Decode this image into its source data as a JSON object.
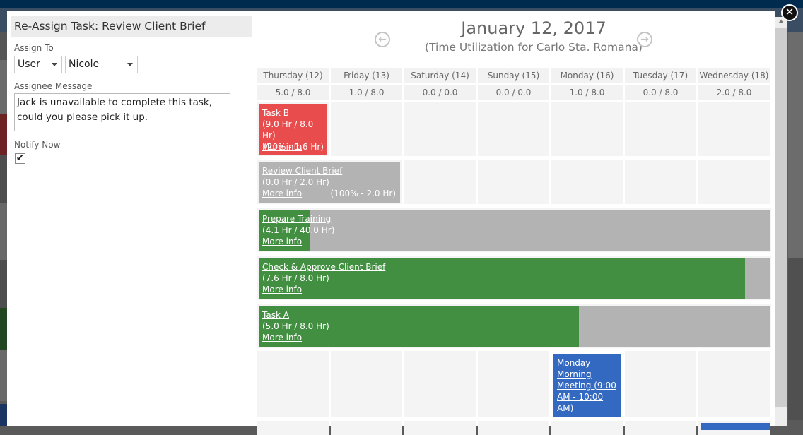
{
  "dialog": {
    "title": "Re-Assign Task: Review Client Brief",
    "assign_to_label": "Assign To",
    "assign_type": "User",
    "assignee": "Nicole",
    "message_label": "Assignee Message",
    "message": "Jack is unavailable to complete this task, could you please pick it up.",
    "notify_label": "Notify Now",
    "notify_checked": true,
    "checkmark": "✔"
  },
  "calendar": {
    "date_title": "January 12, 2017",
    "subtitle": "(Time Utilization for Carlo Sta. Romana)",
    "prev_icon": "←",
    "next_icon": "→",
    "days": [
      {
        "label": "Thursday (12)",
        "usage": "5.0 / 8.0"
      },
      {
        "label": "Friday (13)",
        "usage": "1.0 / 8.0"
      },
      {
        "label": "Saturday (14)",
        "usage": "0.0 / 0.0"
      },
      {
        "label": "Sunday (15)",
        "usage": "0.0 / 0.0"
      },
      {
        "label": "Monday (16)",
        "usage": "1.0 / 8.0"
      },
      {
        "label": "Tuesday (17)",
        "usage": "0.0 / 8.0"
      },
      {
        "label": "Wednesday (18)",
        "usage": "2.0 / 8.0"
      }
    ],
    "tasks": [
      {
        "name": "Task B",
        "hours": "(9.0 Hr / 8.0 Hr)",
        "more": "More info",
        "pct": "(20% - 1.6 Hr)",
        "color": "#e84c4c",
        "progress": 1.0
      },
      {
        "name": "Review Client Brief",
        "hours": "(0.0 Hr / 2.0 Hr)",
        "more": "More info",
        "pct": "(100% - 2.0 Hr)",
        "color": "#b3b3b3",
        "progress": 0.0
      },
      {
        "name": "Prepare Training",
        "hours": "(4.1 Hr / 40.0 Hr)",
        "more": "More info",
        "color": "#438f42",
        "progress": 0.1
      },
      {
        "name": "Check & Approve Client Brief",
        "hours": "(7.6 Hr / 8.0 Hr)",
        "more": "More info",
        "color": "#438f42",
        "progress": 0.95
      },
      {
        "name": "Task A",
        "hours": "(5.0 Hr / 8.0 Hr)",
        "more": "More info",
        "color": "#438f42",
        "progress": 0.625
      }
    ],
    "meeting": {
      "label": "Monday Morning Meeting (9:00 AM - 10:00 AM)",
      "color": "#3369c1"
    }
  },
  "close_icon": "✕"
}
